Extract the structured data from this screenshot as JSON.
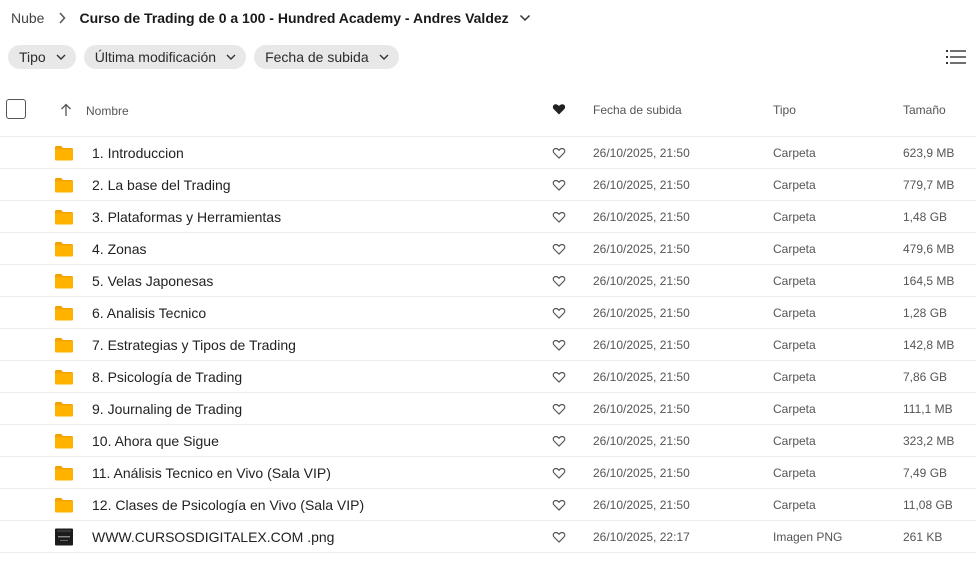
{
  "breadcrumb": {
    "root": "Nube",
    "current": "Curso de Trading de 0 a 100 - Hundred Academy - Andres Valdez"
  },
  "filters": [
    {
      "label": "Tipo"
    },
    {
      "label": "Última modificación"
    },
    {
      "label": "Fecha de subida"
    }
  ],
  "columns": {
    "name": "Nombre",
    "date": "Fecha de subida",
    "type": "Tipo",
    "size": "Tamaño"
  },
  "colors": {
    "folder": "#ffb300",
    "folder_dark": "#f5a000"
  },
  "rows": [
    {
      "name": "1. Introduccion",
      "date": "26/10/2025, 21:50",
      "type": "Carpeta",
      "size": "623,9 MB",
      "icon": "folder-icon"
    },
    {
      "name": "2. La base del Trading",
      "date": "26/10/2025, 21:50",
      "type": "Carpeta",
      "size": "779,7 MB",
      "icon": "folder-icon"
    },
    {
      "name": "3. Plataformas y Herramientas",
      "date": "26/10/2025, 21:50",
      "type": "Carpeta",
      "size": "1,48 GB",
      "icon": "folder-icon"
    },
    {
      "name": "4. Zonas",
      "date": "26/10/2025, 21:50",
      "type": "Carpeta",
      "size": "479,6 MB",
      "icon": "folder-icon"
    },
    {
      "name": "5. Velas Japonesas",
      "date": "26/10/2025, 21:50",
      "type": "Carpeta",
      "size": "164,5 MB",
      "icon": "folder-icon"
    },
    {
      "name": "6. Analisis Tecnico",
      "date": "26/10/2025, 21:50",
      "type": "Carpeta",
      "size": "1,28 GB",
      "icon": "folder-icon"
    },
    {
      "name": "7. Estrategias y Tipos de Trading",
      "date": "26/10/2025, 21:50",
      "type": "Carpeta",
      "size": "142,8 MB",
      "icon": "folder-icon"
    },
    {
      "name": "8. Psicología de Trading",
      "date": "26/10/2025, 21:50",
      "type": "Carpeta",
      "size": "7,86 GB",
      "icon": "folder-icon"
    },
    {
      "name": "9. Journaling de Trading",
      "date": "26/10/2025, 21:50",
      "type": "Carpeta",
      "size": "111,1 MB",
      "icon": "folder-icon"
    },
    {
      "name": "10. Ahora que Sigue",
      "date": "26/10/2025, 21:50",
      "type": "Carpeta",
      "size": "323,2 MB",
      "icon": "folder-icon"
    },
    {
      "name": "11. Análisis Tecnico en Vivo (Sala VIP)",
      "date": "26/10/2025, 21:50",
      "type": "Carpeta",
      "size": "7,49 GB",
      "icon": "folder-icon"
    },
    {
      "name": "12. Clases de Psicología en Vivo (Sala VIP)",
      "date": "26/10/2025, 21:50",
      "type": "Carpeta",
      "size": "11,08 GB",
      "icon": "folder-icon"
    },
    {
      "name": "WWW.CURSOSDIGITALEX.COM .png",
      "date": "26/10/2025, 22:17",
      "type": "Imagen PNG",
      "size": "261 KB",
      "icon": "image-thumbnail-icon"
    }
  ]
}
